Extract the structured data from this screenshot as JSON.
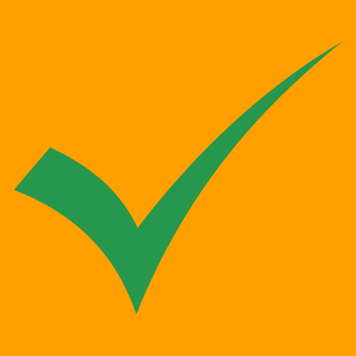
{
  "background_color": "#FF9F00",
  "icon": {
    "name": "checkmark-icon",
    "color": "#26974C"
  }
}
